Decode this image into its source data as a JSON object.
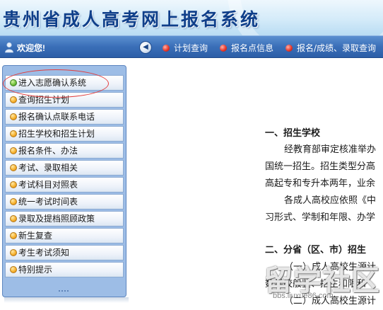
{
  "header": {
    "title": "贵州省成人高考网上报名系统"
  },
  "navbar": {
    "welcome": "欢迎您!",
    "user_icon": "user-icon",
    "back_icon": "back-arrow-icon",
    "back_glyph": "◀",
    "links": [
      {
        "label": "计划查询"
      },
      {
        "label": "报名点信息"
      },
      {
        "label": "报名/成绩、录取查询"
      }
    ]
  },
  "sidebar": {
    "items": [
      {
        "label": "进入志愿确认系统",
        "bullet": "green"
      },
      {
        "label": "查询招生计划",
        "bullet": "orange"
      },
      {
        "label": "报名确认点联系电话",
        "bullet": "orange"
      },
      {
        "label": "招生学校和招生计划",
        "bullet": "orange"
      },
      {
        "label": "报名条件、办法",
        "bullet": "orange"
      },
      {
        "label": "考试、录取相关",
        "bullet": "orange"
      },
      {
        "label": "考试科目对照表",
        "bullet": "orange"
      },
      {
        "label": "统一考试时间表",
        "bullet": "orange"
      },
      {
        "label": "录取及提档照顾政策",
        "bullet": "orange"
      },
      {
        "label": "新生复查",
        "bullet": "orange"
      },
      {
        "label": "考生考试须知",
        "bullet": "orange"
      },
      {
        "label": "特别提示",
        "bullet": "orange"
      }
    ]
  },
  "content": {
    "lines": [
      "一、招生学校",
      "经教育部审定核准举办",
      "国统一招生。招生类型分高",
      "高起专和专升本两年，业余",
      "各成人高校应依照《中",
      "习形式、学制和年限、办学",
      "二、分省（区、市）招生",
      "（一）成人高校生源计",
      "数学校般鉴、招生和限和",
      "（二）成人高校生源计"
    ]
  },
  "watermark": {
    "text": "留学社区",
    "url": "bbs.liuxue86.com"
  },
  "colors": {
    "title": "#0f3f8a",
    "navbar": "#3a6fb8",
    "sidebar_bg": "#9dbde6",
    "annotation_circle": "#e23c3c"
  }
}
